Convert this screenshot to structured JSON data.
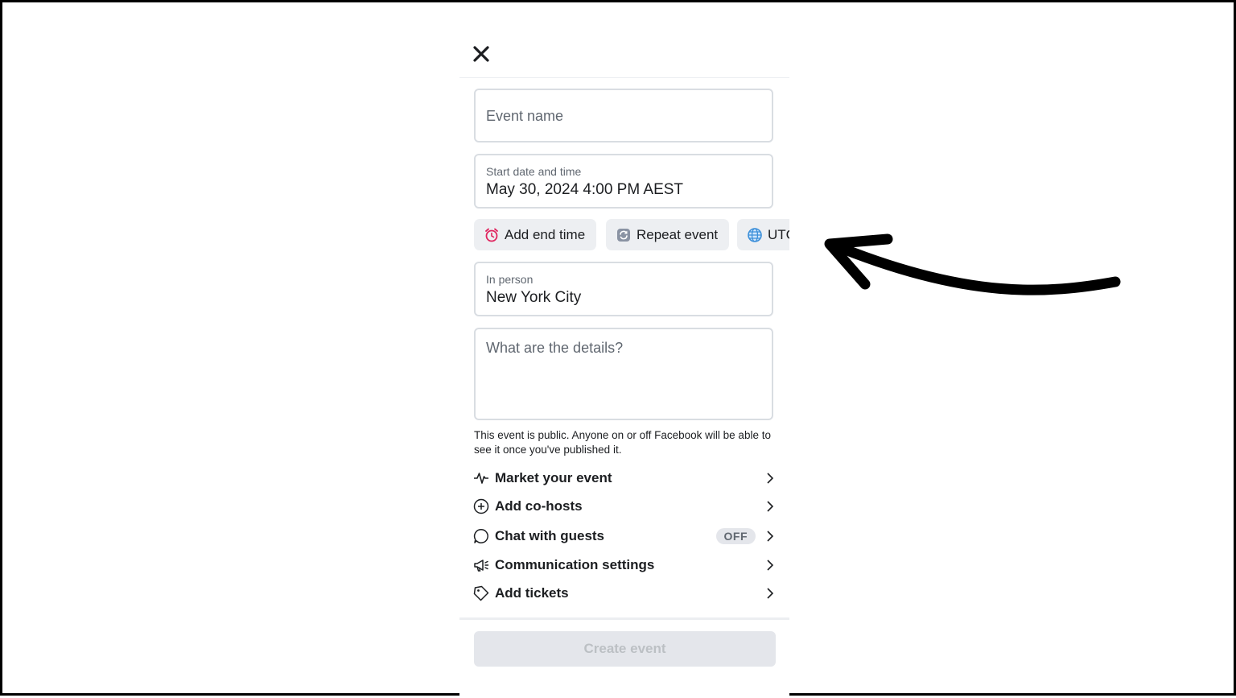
{
  "form": {
    "event_name_placeholder": "Event name",
    "start_label": "Start date and time",
    "start_value": "May 30, 2024 4:00 PM AEST",
    "location_label": "In person",
    "location_value": "New York City",
    "details_placeholder": "What are the details?"
  },
  "chips": {
    "end_time": "Add end time",
    "repeat": "Repeat event",
    "timezone": "UTC"
  },
  "notice": "This event is public. Anyone on or off Facebook will be able to see it once you've published it.",
  "options": {
    "market": "Market your event",
    "cohosts": "Add co-hosts",
    "chat": "Chat with guests",
    "chat_badge": "OFF",
    "communication": "Communication settings",
    "tickets": "Add tickets"
  },
  "footer": {
    "create_label": "Create event"
  },
  "colors": {
    "field_border": "#d9dde2",
    "chip_bg": "#edeff2",
    "disabled_button": "#e4e6eb",
    "alarm": "#e0245e",
    "globe": "#3b8fd9"
  },
  "icons": [
    "close-icon",
    "alarm-clock-icon",
    "repeat-icon",
    "globe-icon",
    "pulse-icon",
    "plus-circle-icon",
    "chat-bubble-icon",
    "megaphone-icon",
    "ticket-icon",
    "chevron-right-icon",
    "arrow-annotation"
  ]
}
